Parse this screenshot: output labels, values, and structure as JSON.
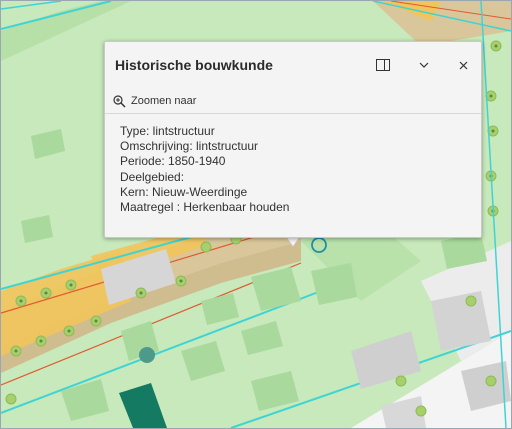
{
  "popup": {
    "title": "Historische bouwkunde",
    "dock_icon": "dock-side-icon",
    "collapse_icon": "chevron-down-icon",
    "close_icon": "close-icon",
    "zoom_icon": "zoom-in-icon",
    "zoom_label": "Zoomen naar",
    "attributes": [
      "Type: lintstructuur",
      "Omschrijving: lintstructuur",
      "Periode: 1850-1940",
      "Deelgebied:",
      "Kern: Nieuw-Weerdinge",
      "Maatregel : Herkenbaar houden"
    ]
  },
  "colors": {
    "map_green": "#c4e8b8",
    "building": "#a8d99b",
    "road": "#d9c79b",
    "parcel_line": "#3fd4d4",
    "highlight": "#f1c45c",
    "lint_line": "#e2592d",
    "dark_feature": "#157a62"
  }
}
